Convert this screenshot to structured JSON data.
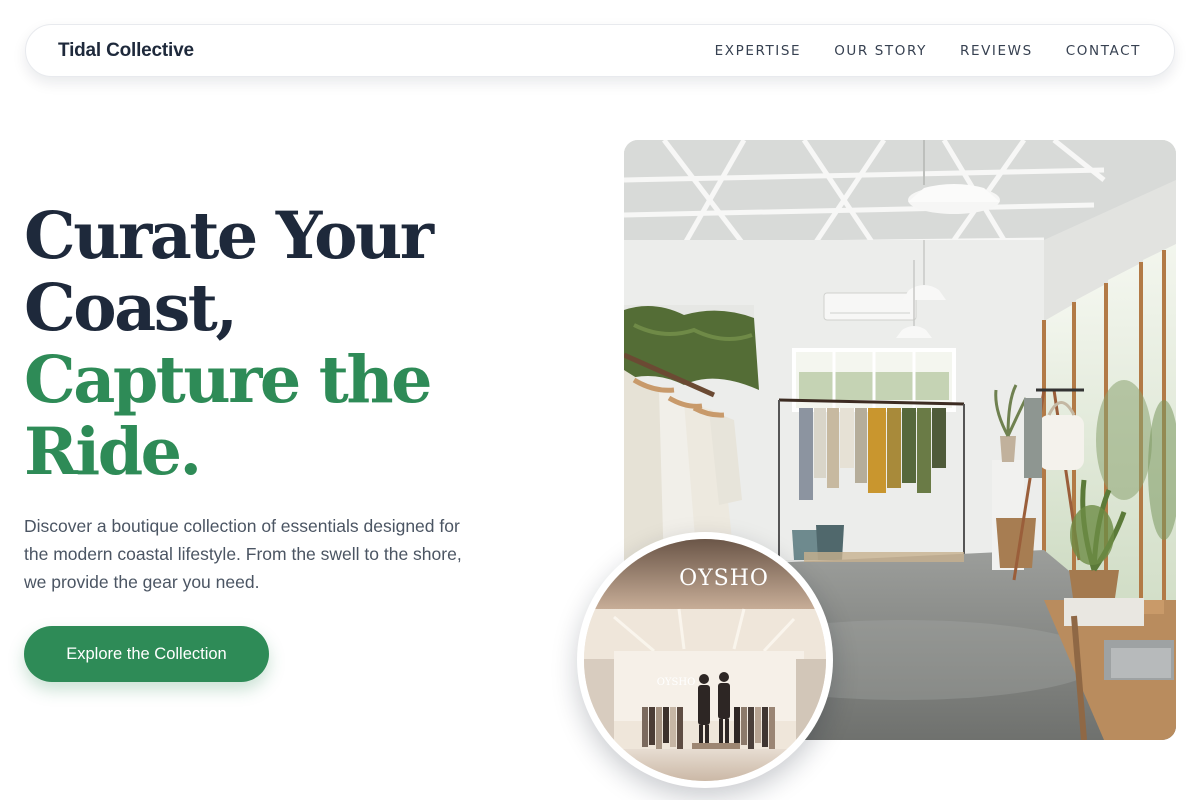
{
  "header": {
    "brand": "Tidal Collective",
    "nav": [
      "EXPERTISE",
      "OUR STORY",
      "REVIEWS",
      "CONTACT"
    ]
  },
  "hero": {
    "title_dark": [
      "Curate Your",
      "Coast,"
    ],
    "title_green": [
      "Capture the",
      "Ride."
    ],
    "description": "Discover a boutique collection of essentials designed for the modern coastal lifestyle. From the swell to the shore, we provide the gear you need.",
    "cta_label": "Explore the Collection"
  },
  "images": {
    "main_photo": "boutique-interior-photo",
    "inset_photo": "oysho-storefront-photo",
    "inset_sign_large": "OYSHO",
    "inset_sign_small": "OYSHO"
  },
  "colors": {
    "navy": "#1e293b",
    "green": "#2e8b57",
    "text_gray": "#4b5563"
  }
}
